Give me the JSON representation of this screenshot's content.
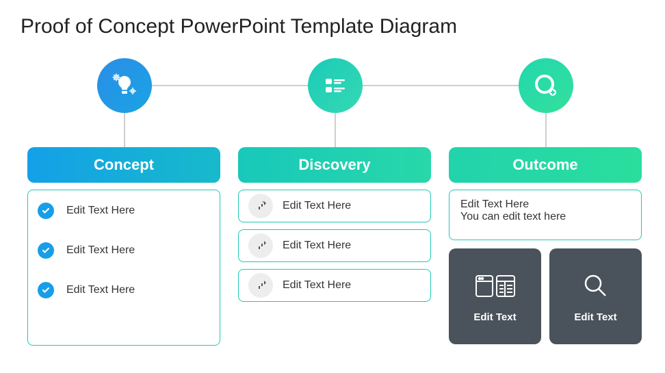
{
  "title": "Proof of Concept PowerPoint Template Diagram",
  "columns": {
    "concept": {
      "label": "Concept",
      "items": [
        "Edit Text Here",
        "Edit Text Here",
        "Edit Text Here"
      ]
    },
    "discovery": {
      "label": "Discovery",
      "items": [
        "Edit Text Here",
        "Edit Text Here",
        "Edit Text Here"
      ]
    },
    "outcome": {
      "label": "Outcome",
      "text1": "Edit Text Here",
      "text2": "You can edit text here",
      "cards": [
        "Edit Text",
        "Edit Text"
      ]
    }
  }
}
